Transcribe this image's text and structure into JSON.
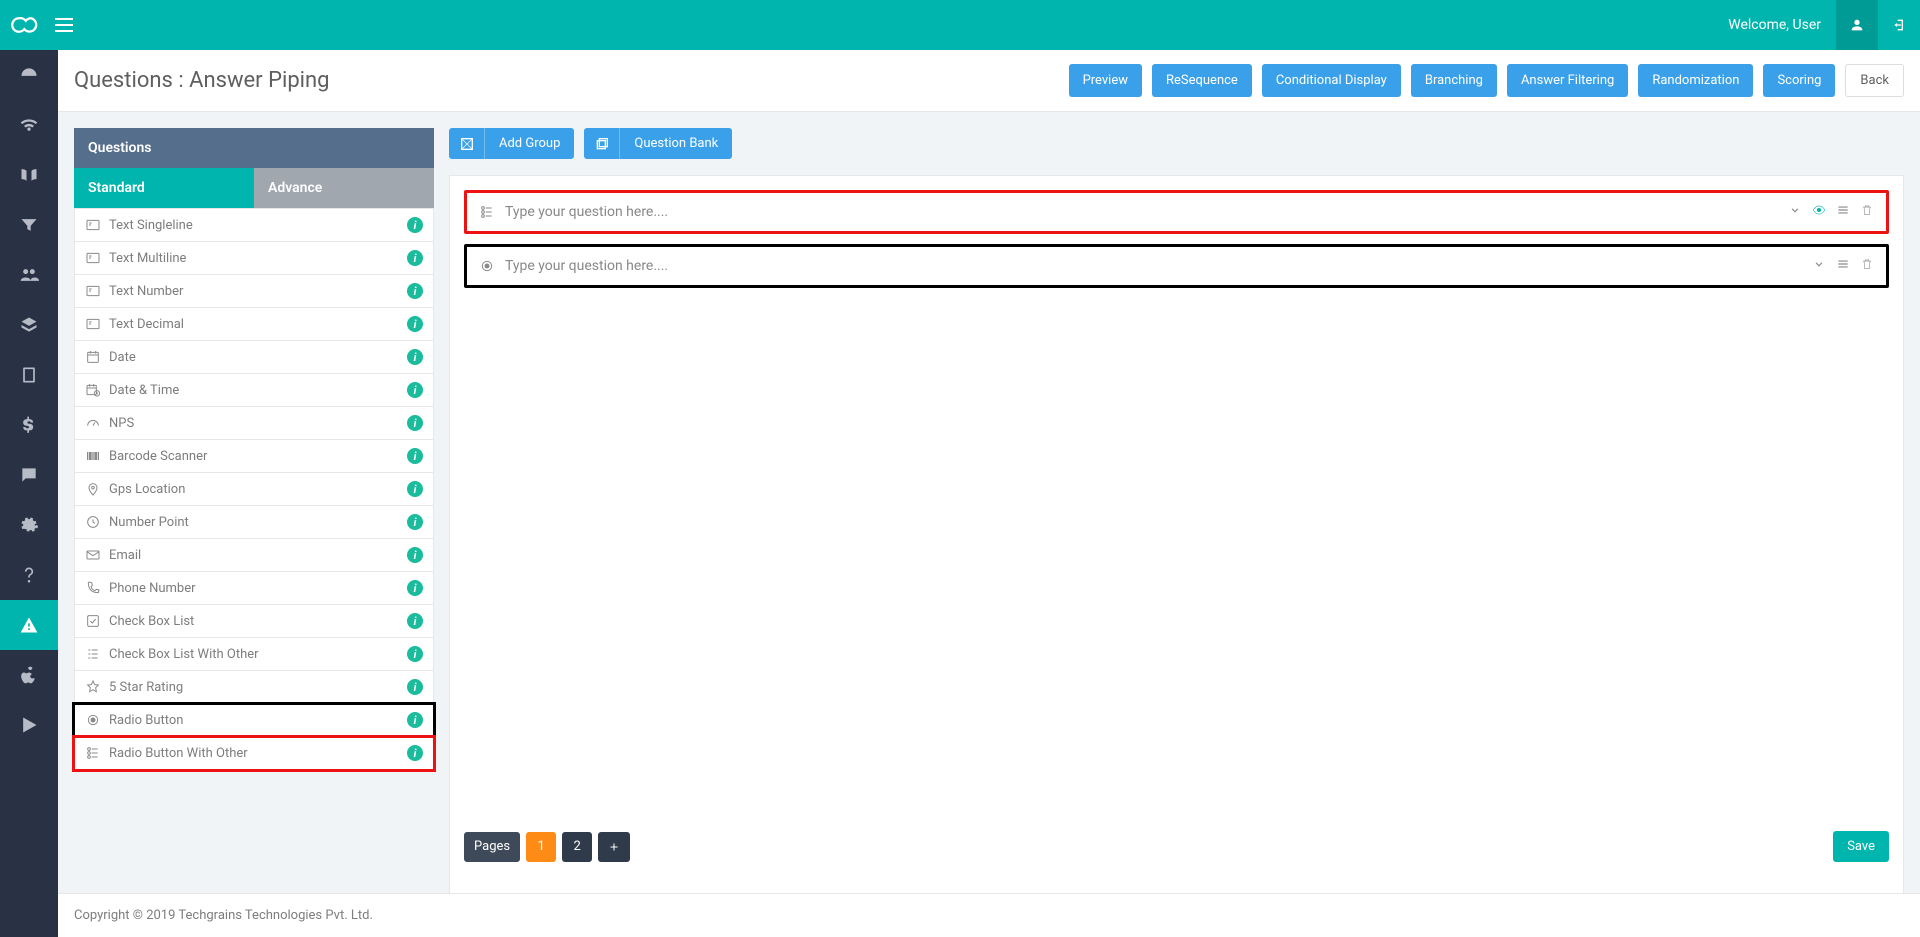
{
  "header": {
    "welcome": "Welcome, User"
  },
  "page": {
    "title_prefix": "Questions : ",
    "title_name": "Answer Piping",
    "actions": {
      "preview": "Preview",
      "resequence": "ReSequence",
      "conditional": "Conditional Display",
      "branching": "Branching",
      "filtering": "Answer Filtering",
      "randomization": "Randomization",
      "scoring": "Scoring",
      "back": "Back"
    }
  },
  "qpanel": {
    "title": "Questions",
    "tabs": {
      "standard": "Standard",
      "advance": "Advance"
    },
    "items": [
      {
        "label": "Text Singleline",
        "icon": "text"
      },
      {
        "label": "Text Multiline",
        "icon": "text"
      },
      {
        "label": "Text Number",
        "icon": "text"
      },
      {
        "label": "Text Decimal",
        "icon": "text"
      },
      {
        "label": "Date",
        "icon": "cal"
      },
      {
        "label": "Date & Time",
        "icon": "caltime"
      },
      {
        "label": "NPS",
        "icon": "nps"
      },
      {
        "label": "Barcode Scanner",
        "icon": "barcode"
      },
      {
        "label": "Gps Location",
        "icon": "pin"
      },
      {
        "label": "Number Point",
        "icon": "clock"
      },
      {
        "label": "Email",
        "icon": "mail"
      },
      {
        "label": "Phone Number",
        "icon": "phone"
      },
      {
        "label": "Check Box List",
        "icon": "check"
      },
      {
        "label": "Check Box List With Other",
        "icon": "checklist"
      },
      {
        "label": "5 Star Rating",
        "icon": "star"
      },
      {
        "label": "Radio Button",
        "icon": "radio",
        "highlight": "black"
      },
      {
        "label": "Radio Button With Other",
        "icon": "radiolist",
        "highlight": "red"
      }
    ]
  },
  "toolbar": {
    "add_group": "Add Group",
    "question_bank": "Question Bank"
  },
  "questions": [
    {
      "placeholder": "Type your question here....",
      "icon": "radiolist",
      "highlight": "red",
      "show_eye": true
    },
    {
      "placeholder": "Type your question here....",
      "icon": "radio",
      "highlight": "black",
      "show_eye": false
    }
  ],
  "pager": {
    "label": "Pages",
    "pages": [
      "1",
      "2"
    ]
  },
  "save_label": "Save",
  "footer": "Copyright © 2019 Techgrains Technologies Pvt. Ltd."
}
